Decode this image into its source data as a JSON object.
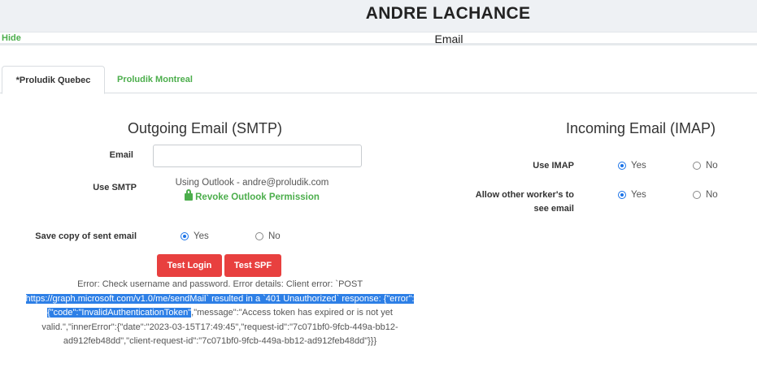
{
  "header": {
    "user_name": "ANDRE LACHANCE"
  },
  "subbar": {
    "hide_label": "Hide",
    "section_title": "Email"
  },
  "tabs": [
    {
      "label": "*Proludik Quebec",
      "active": true
    },
    {
      "label": "Proludik Montreal",
      "active": false
    }
  ],
  "outgoing": {
    "title": "Outgoing Email (SMTP)",
    "email_label": "Email",
    "email_value": "",
    "use_smtp_label": "Use SMTP",
    "smtp_status": "Using Outlook - andre@proludik.com",
    "revoke_label": "Revoke Outlook Permission",
    "save_copy_label": "Save copy of sent email",
    "save_copy_yes": "Yes",
    "save_copy_no": "No",
    "save_copy_selected": "Yes",
    "test_login_label": "Test Login",
    "test_spf_label": "Test SPF"
  },
  "error": {
    "line1": "Error: Check username and password. Error details: Client error: `POST",
    "selected": "https://graph.microsoft.com/v1.0/me/sendMail` resulted in a `401 Unauthorized` response: {\"error\":{\"code\":\"InvalidAuthenticationToken\"",
    "rest": ",\"message\":\"Access token has expired or is not yet valid.\",\"innerError\":{\"date\":\"2023-03-15T17:49:45\",\"request-id\":\"7c071bf0-9fcb-449a-bb12-ad912feb48dd\",\"client-request-id\":\"7c071bf0-9fcb-449a-bb12-ad912feb48dd\"}}}"
  },
  "incoming": {
    "title": "Incoming Email (IMAP)",
    "use_imap_label": "Use IMAP",
    "use_imap_yes": "Yes",
    "use_imap_no": "No",
    "use_imap_selected": "Yes",
    "allow_others_label_1": "Allow other worker's to",
    "allow_others_label_2": "see email",
    "allow_yes": "Yes",
    "allow_no": "No",
    "allow_selected": "Yes"
  },
  "colors": {
    "accent_green": "#4cae4c",
    "danger_red": "#e8403f",
    "selection_blue": "#2d7fe6"
  }
}
